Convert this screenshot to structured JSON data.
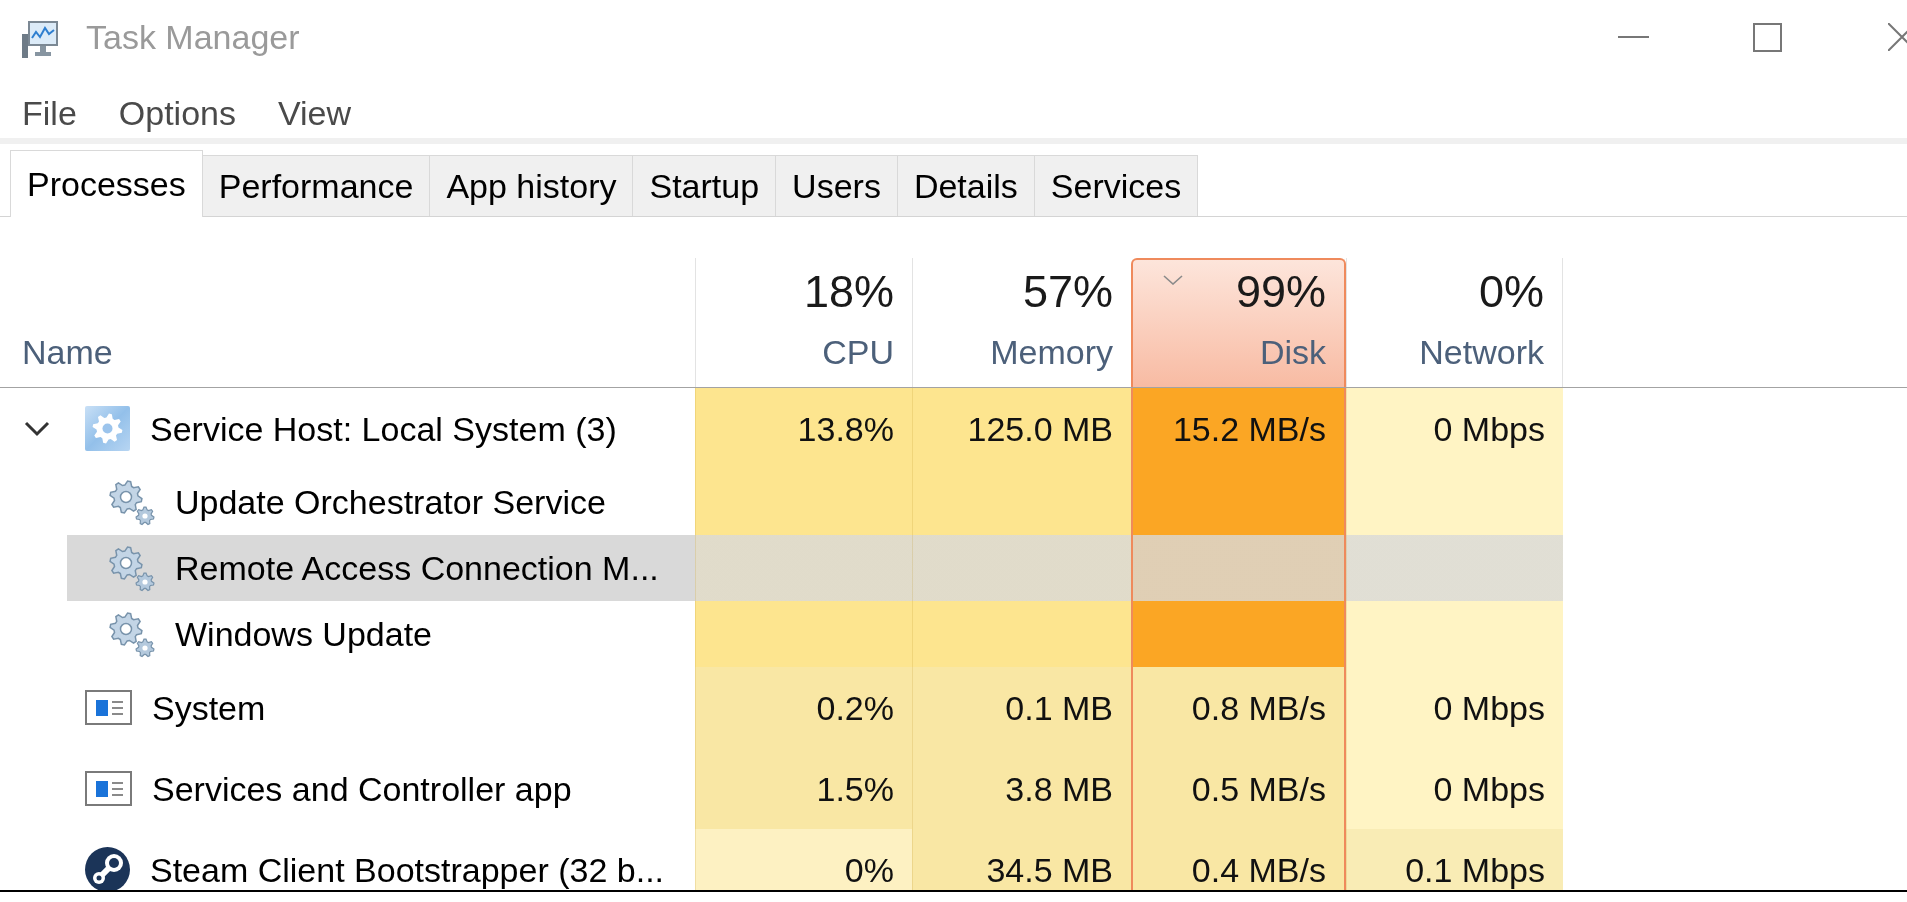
{
  "window": {
    "title": "Task Manager"
  },
  "menu": [
    "File",
    "Options",
    "View"
  ],
  "tabs": [
    {
      "label": "Processes",
      "selected": true
    },
    {
      "label": "Performance",
      "selected": false
    },
    {
      "label": "App history",
      "selected": false
    },
    {
      "label": "Startup",
      "selected": false
    },
    {
      "label": "Users",
      "selected": false
    },
    {
      "label": "Details",
      "selected": false
    },
    {
      "label": "Services",
      "selected": false
    }
  ],
  "table": {
    "name_column": {
      "label": "Name",
      "sorted": false
    },
    "columns": [
      {
        "label": "CPU",
        "total": "18%",
        "sorted": false
      },
      {
        "label": "Memory",
        "total": "57%",
        "sorted": false
      },
      {
        "label": "Disk",
        "total": "99%",
        "sorted": true
      },
      {
        "label": "Network",
        "total": "0%",
        "sorted": false
      }
    ],
    "rows": [
      {
        "kind": "host",
        "name": "Service Host: Local System (3)",
        "selected": false,
        "expanded": true,
        "cells": [
          {
            "text": "13.8%",
            "color": "#fde58f"
          },
          {
            "text": "125.0 MB",
            "color": "#fde58f"
          },
          {
            "text": "15.2 MB/s",
            "color": "#fba624"
          },
          {
            "text": "0 Mbps",
            "color": "#fff4c4"
          }
        ],
        "children": [
          {
            "kind": "service",
            "name": "Update Orchestrator Service",
            "selected": false
          },
          {
            "kind": "service",
            "name": "Remote Access Connection M...",
            "selected": true
          },
          {
            "kind": "service",
            "name": "Windows Update",
            "selected": false
          }
        ]
      },
      {
        "kind": "window",
        "name": "System",
        "selected": false,
        "cells": [
          {
            "text": "0.2%",
            "color": "#f9e7a4"
          },
          {
            "text": "0.1 MB",
            "color": "#f9e7a4"
          },
          {
            "text": "0.8 MB/s",
            "color": "#f9e7a4"
          },
          {
            "text": "0 Mbps",
            "color": "#fff4c4"
          }
        ]
      },
      {
        "kind": "window",
        "name": "Services and Controller app",
        "selected": false,
        "cells": [
          {
            "text": "1.5%",
            "color": "#f9e7a4"
          },
          {
            "text": "3.8 MB",
            "color": "#f9e7a4"
          },
          {
            "text": "0.5 MB/s",
            "color": "#f9e7a4"
          },
          {
            "text": "0 Mbps",
            "color": "#fff4c4"
          }
        ]
      },
      {
        "kind": "client",
        "name": "Steam Client Bootstrapper (32 b...",
        "selected": false,
        "cells": [
          {
            "text": "0%",
            "color": "#fdf1c2"
          },
          {
            "text": "34.5 MB",
            "color": "#f9e7a4"
          },
          {
            "text": "0.4 MB/s",
            "color": "#f9e7a4"
          },
          {
            "text": "0.1 Mbps",
            "color": "#f9ecb5"
          }
        ]
      }
    ]
  }
}
